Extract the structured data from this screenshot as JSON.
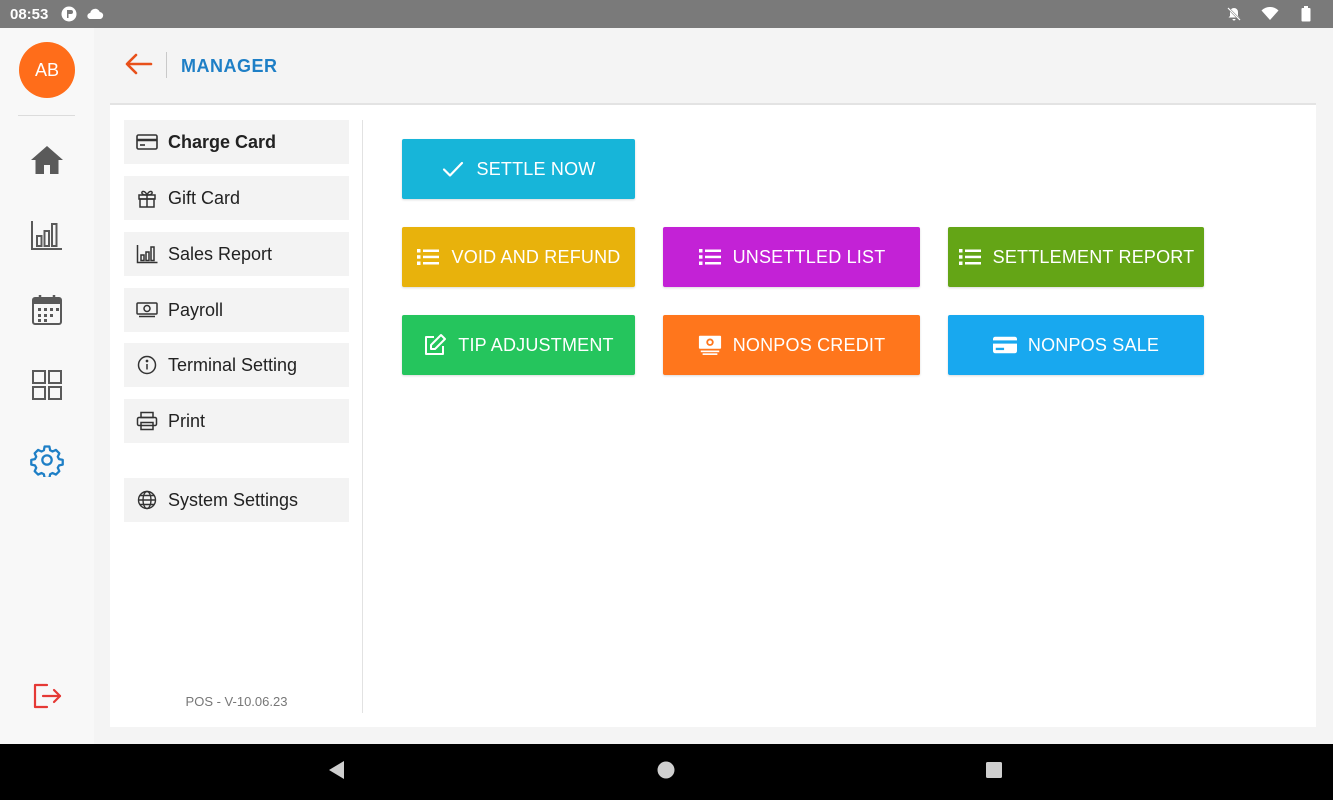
{
  "status_bar": {
    "time": "08:53"
  },
  "user": {
    "initials": "AB"
  },
  "header": {
    "title": "MANAGER"
  },
  "menu": {
    "items": [
      {
        "label": "Charge Card",
        "icon": "credit-card-icon"
      },
      {
        "label": "Gift Card",
        "icon": "gift-icon"
      },
      {
        "label": "Sales Report",
        "icon": "bar-chart-icon"
      },
      {
        "label": "Payroll",
        "icon": "money-icon"
      },
      {
        "label": "Terminal Setting",
        "icon": "info-icon"
      },
      {
        "label": "Print",
        "icon": "printer-icon"
      },
      {
        "label": "System Settings",
        "icon": "globe-icon"
      }
    ],
    "version": "POS - V-10.06.23"
  },
  "actions": {
    "settle_now": "SETTLE NOW",
    "void_and_refund": "VOID AND REFUND",
    "unsettled_list": "UNSETTLED LIST",
    "settlement_report": "SETTLEMENT REPORT",
    "tip_adjustment": "TIP ADJUSTMENT",
    "nonpos_credit": "NONPOS CREDIT",
    "nonpos_sale": "NONPOS SALE"
  },
  "colors": {
    "accent": "#1e7fc6",
    "avatar": "#ff6d1a",
    "settle_now": "#17b5d9",
    "void_and_refund": "#e8b20c",
    "unsettled_list": "#c322d6",
    "settlement_report": "#64a516",
    "tip_adjustment": "#25c55d",
    "nonpos_credit": "#ff761c",
    "nonpos_sale": "#18a8ef",
    "logout": "#e53935"
  }
}
